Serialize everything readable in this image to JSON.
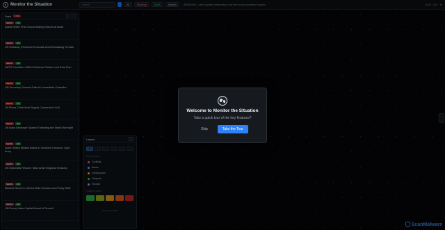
{
  "app": {
    "title": "Monitor the Situation"
  },
  "topbar": {
    "search_placeholder": "Search",
    "chips": [
      "",
      "All",
      "Breaking",
      "Alerts",
      "Markets"
    ],
    "ticker": "BREAKING: Latest updates streaming in real time across monitored regions",
    "right": [
      "12:00",
      "UTC",
      "⚙"
    ]
  },
  "news_panel": {
    "title": "Feed",
    "live_label": "LIVE",
    "items": [
      {
        "src": "NEWS",
        "cat": "US",
        "time": "",
        "title": "Israeli Netflix Prize Drama Making Waves at Israel",
        "source": ""
      },
      {
        "src": "NEWS",
        "cat": "US",
        "time": "",
        "title": "US Embassy Personnel Evacuate Amid Escalating Threats",
        "source": ""
      },
      {
        "src": "NEWS",
        "cat": "US",
        "time": "",
        "title": "NATO Considers Shift of Defense Posture and Role Plan",
        "source": ""
      },
      {
        "src": "NEWS",
        "cat": "US",
        "time": "",
        "title": "UN Secretary-General Calls for Immediate Ceasefire",
        "source": ""
      },
      {
        "src": "NEWS",
        "cat": "US",
        "time": "",
        "title": "Oil Prices Climb Amid Supply Concerns in Gulf",
        "source": ""
      },
      {
        "src": "NEWS",
        "cat": "US",
        "time": "",
        "title": "US Navy Destroyer Spotted Transiting the Strait Overnight",
        "source": ""
      },
      {
        "src": "NEWS",
        "cat": "US",
        "time": "",
        "title": "Israel Strikes Militant Bases in Southern Lebanon, Says Army",
        "source": ""
      },
      {
        "src": "NEWS",
        "cat": "US",
        "time": "",
        "title": "US Diplomats Resume Talks Amid Regional Tensions",
        "source": ""
      },
      {
        "src": "NEWS",
        "cat": "US",
        "time": "",
        "title": "Markets React to Interest Rate Decision and Policy Shift",
        "source": ""
      },
      {
        "src": "NEWS",
        "cat": "US",
        "time": "",
        "title": "UN Envoy Visits Capital Ahead of Summit",
        "source": ""
      }
    ]
  },
  "layers_panel": {
    "title": "Layers",
    "section1": "Data Layers",
    "rows": [
      {
        "label": "Conflicts",
        "color": "#ff5a5a",
        "count": ""
      },
      {
        "label": "Bases",
        "color": "#4aa3ff",
        "count": ""
      },
      {
        "label": "Earthquakes",
        "color": "#f5a623",
        "count": ""
      },
      {
        "label": "Hotspots",
        "color": "#3fb950",
        "count": ""
      },
      {
        "label": "Vessels",
        "color": "#c07cff",
        "count": ""
      }
    ],
    "section2": "Threat Level",
    "swatches": [
      "#2ea043",
      "#8a9a1e",
      "#c98a1e",
      "#c9531e",
      "#b62324"
    ],
    "footer": "Press ? for help"
  },
  "modal": {
    "title": "Welcome to Monitor the Situation",
    "subtitle": "Take a quick tour of the key features?",
    "skip_label": "Skip",
    "tour_label": "Take the Tour"
  },
  "watermark": "ScanMalware"
}
